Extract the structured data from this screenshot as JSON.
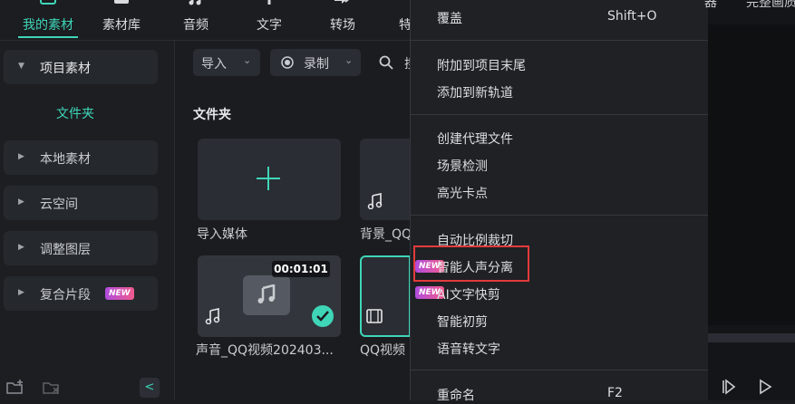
{
  "tabs": [
    {
      "label": "我的素材",
      "icon": "my-media-icon",
      "active": true
    },
    {
      "label": "素材库",
      "icon": "stock-media-icon",
      "active": false
    },
    {
      "label": "音频",
      "icon": "audio-icon",
      "active": false
    },
    {
      "label": "文字",
      "icon": "text-icon",
      "active": false
    },
    {
      "label": "转场",
      "icon": "transition-icon",
      "active": false
    },
    {
      "label": "特",
      "icon": "effects-icon",
      "active": false
    }
  ],
  "sidebar": {
    "items": [
      {
        "label": "项目素材",
        "expanded": true
      },
      {
        "label": "本地素材"
      },
      {
        "label": "云空间"
      },
      {
        "label": "调整图层"
      },
      {
        "label": "复合片段",
        "badge": "NEW"
      }
    ],
    "folder_label": "文件夹"
  },
  "toolbar": {
    "import_label": "导入",
    "record_label": "录制",
    "search_partial": "搜"
  },
  "main": {
    "section_title": "文件夹",
    "cards": [
      {
        "label": "导入媒体",
        "kind": "import"
      },
      {
        "label": "背景_QQ",
        "kind": "audio"
      },
      {
        "label": "声音_QQ视频202403...",
        "kind": "audio",
        "duration": "00:01:01",
        "checked": true
      },
      {
        "label": "QQ视频",
        "kind": "video"
      }
    ]
  },
  "context_menu": {
    "groups": [
      [
        {
          "label": "覆盖",
          "shortcut": "Shift+O"
        }
      ],
      [
        {
          "label": "附加到项目末尾"
        },
        {
          "label": "添加到新轨道"
        }
      ],
      [
        {
          "label": "创建代理文件"
        },
        {
          "label": "场景检测"
        },
        {
          "label": "高光卡点"
        }
      ],
      [
        {
          "label": "自动比例裁切"
        },
        {
          "label": "智能人声分离",
          "badge": "NEW",
          "highlighted": true
        },
        {
          "label": "AI文字快剪",
          "badge": "NEW"
        },
        {
          "label": "智能初剪"
        },
        {
          "label": "语音转文字"
        }
      ],
      [
        {
          "label": "重命名",
          "shortcut": "F2"
        }
      ]
    ]
  },
  "right_panel": {
    "tab_partial_1": "器",
    "tab_partial_2": "完整画质"
  },
  "colors": {
    "accent": "#3fd6b8",
    "highlight_border": "#e23b3b",
    "badge_from": "#b04de0",
    "badge_to": "#f05a8c"
  }
}
